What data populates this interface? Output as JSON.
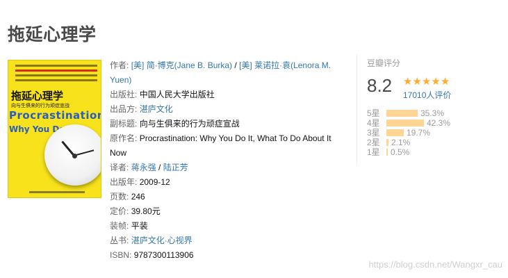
{
  "title": "拖延心理学",
  "cover": {
    "title_cn": "拖延心理学",
    "subtitle": "向与生俱来的行为顽症宣战",
    "title_en": "Procrastination",
    "why": "Why You Do It"
  },
  "info": {
    "author_label": "作者:",
    "author1": "[美] 简·博克(Jane B. Burka)",
    "sep": " / ",
    "author2": "[美] 莱诺拉·袁(Lenora M. Yuen)",
    "publisher_label": "出版社:",
    "publisher": "中国人民大学出版社",
    "producer_label": "出品方:",
    "producer": "湛庐文化",
    "subtitle_label": "副标题:",
    "subtitle": "向与生俱来的行为顽症宣战",
    "original_label": "原作名:",
    "original": "Procrastination: Why You Do It, What To Do About It Now",
    "translator_label": "译者:",
    "translator1": "蒋永强",
    "translator2": "陆正芳",
    "pubdate_label": "出版年:",
    "pubdate": "2009-12",
    "pages_label": "页数:",
    "pages": "246",
    "price_label": "定价:",
    "price": "39.80元",
    "binding_label": "装帧:",
    "binding": "平装",
    "series_label": "丛书:",
    "series": "湛庐文化·心视界",
    "isbn_label": "ISBN:",
    "isbn": "9787300113906"
  },
  "rating": {
    "label": "豆瓣评分",
    "score": "8.2",
    "stars": 4.5,
    "votes": "17010人评价",
    "accent": "#ffac2d",
    "bar_color": "#ffd596",
    "distribution": [
      {
        "label": "5星",
        "pct": "35.3%",
        "value": 35.3
      },
      {
        "label": "4星",
        "pct": "42.3%",
        "value": 42.3
      },
      {
        "label": "3星",
        "pct": "19.7%",
        "value": 19.7
      },
      {
        "label": "2星",
        "pct": "2.1%",
        "value": 2.1
      },
      {
        "label": "1星",
        "pct": "0.5%",
        "value": 0.5
      }
    ]
  },
  "watermark": "https://blog.csdn.net/Wangxr_cau"
}
